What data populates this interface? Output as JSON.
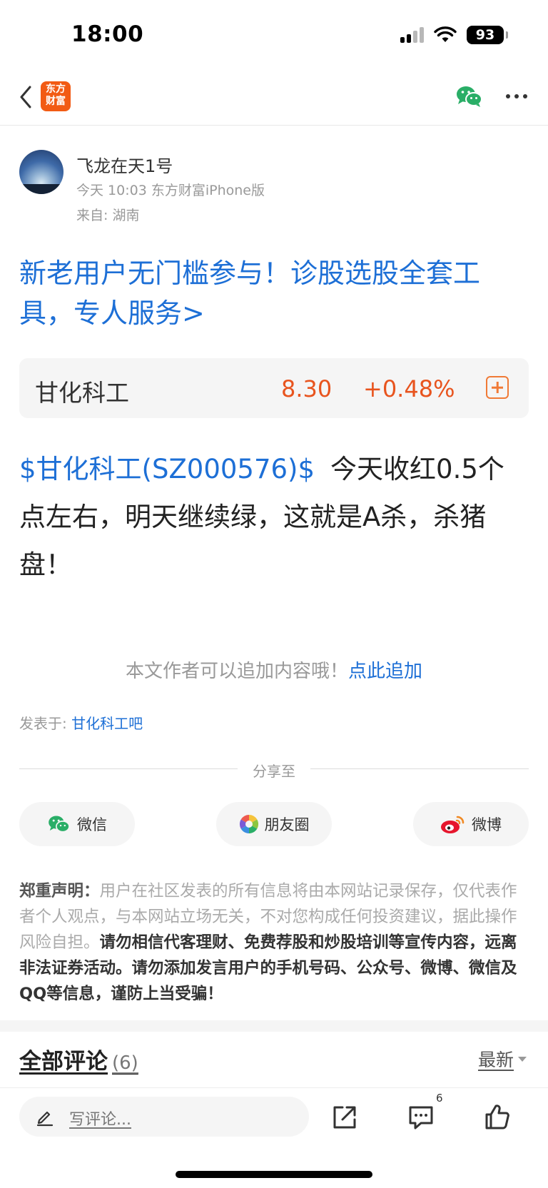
{
  "status_bar": {
    "time": "18:00",
    "battery": "93"
  },
  "nav": {
    "logo_line1": "东方",
    "logo_line2": "财富"
  },
  "author": {
    "name": "飞龙在天1号",
    "meta": "今天 10:03 东方财富iPhone版",
    "from": "来自: 湖南"
  },
  "promo": {
    "text": "新老用户无门槛参与！诊股选股全套工具，专人服务>"
  },
  "stock": {
    "name": "甘化科工",
    "price": "8.30",
    "change": "+0.48%"
  },
  "post": {
    "stock_link": "$甘化科工(SZ000576)$",
    "body": "今天收红0.5个点左右，明天继续绿，这就是A杀，杀猪盘！"
  },
  "append": {
    "text": "本文作者可以追加内容哦！",
    "link": "点此追加"
  },
  "posted_in": {
    "label": "发表于: ",
    "link": "甘化科工吧"
  },
  "share": {
    "title": "分享至",
    "wechat": "微信",
    "moments": "朋友圈",
    "weibo": "微博"
  },
  "disclaimer": {
    "label": "郑重声明：",
    "text": "用户在社区发表的所有信息将由本网站记录保存，仅代表作者个人观点，与本网站立场无关，不对您构成任何投资建议，据此操作风险自担。",
    "emphasis": "请勿相信代客理财、免费荐股和炒股培训等宣传内容，远离非法证券活动。请勿添加发言用户的手机号码、公众号、微博、微信及QQ等信息，谨防上当受骗！"
  },
  "comments": {
    "title": "全部评论",
    "count": "(6)",
    "sort": "最新"
  },
  "bottom_bar": {
    "placeholder": "写评论...",
    "comment_badge": "6"
  },
  "colors": {
    "brand": "#f25b14",
    "link": "#1d6fd6",
    "up": "#e8541e",
    "wechat": "#2aae67"
  }
}
